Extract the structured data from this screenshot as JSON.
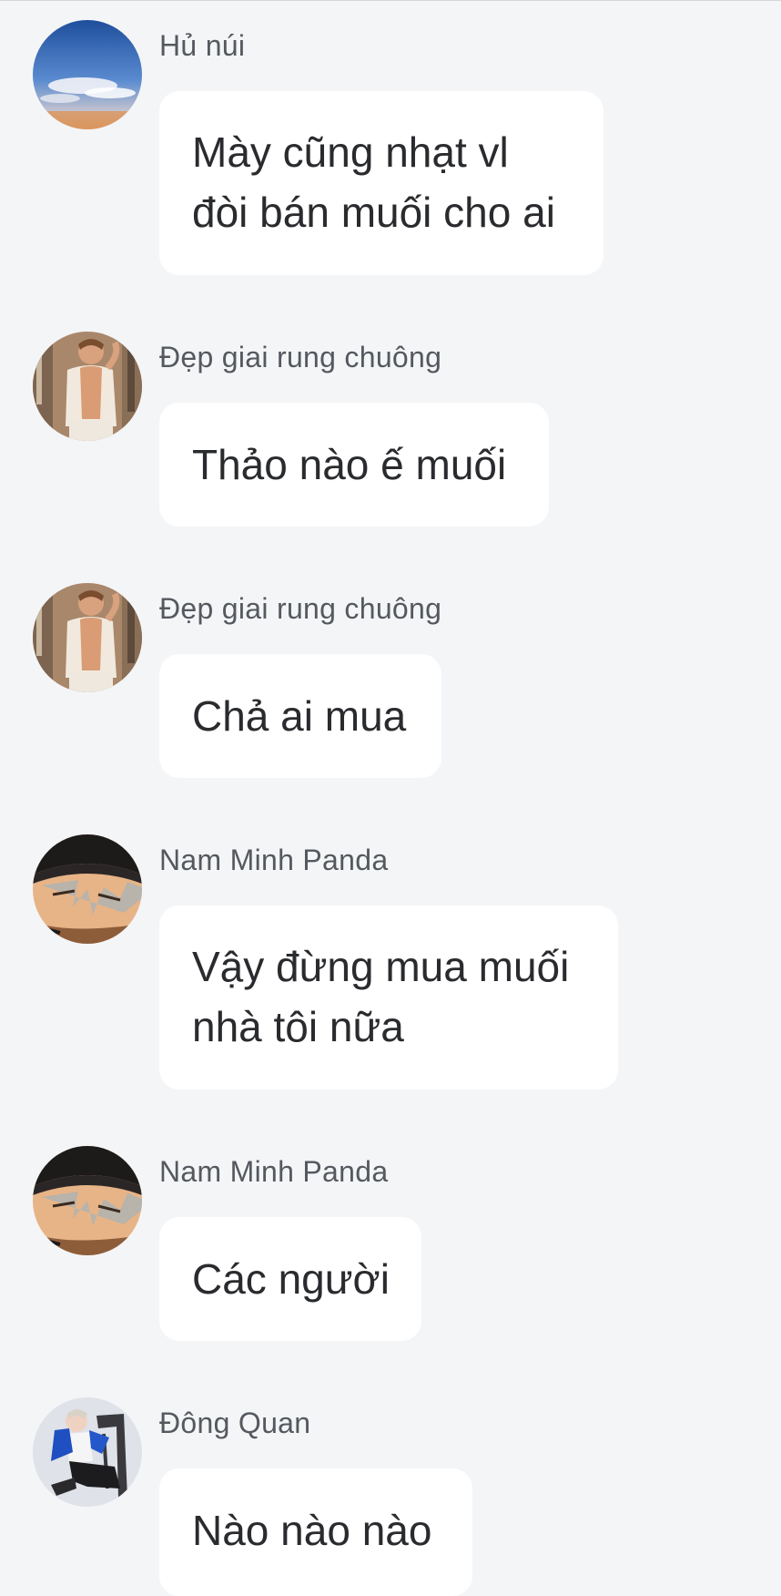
{
  "messages": [
    {
      "sender": "Hủ núi",
      "avatar_icon": "sky-clouds-avatar-icon",
      "lines": [
        "Mày cũng nhạt vl",
        "đòi bán muối cho ai"
      ]
    },
    {
      "sender": "Đẹp giai rung chuông",
      "avatar_icon": "shirtless-man-avatar-icon",
      "lines": [
        "Thảo nào ế muối"
      ]
    },
    {
      "sender": "Đẹp giai rung chuông",
      "avatar_icon": "shirtless-man-avatar-icon",
      "lines": [
        "Chả ai mua"
      ]
    },
    {
      "sender": "Nam Minh Panda",
      "avatar_icon": "anime-hat-character-avatar-icon",
      "lines": [
        "Vậy đừng mua muối",
        "nhà tôi nữa"
      ]
    },
    {
      "sender": "Nam Minh Panda",
      "avatar_icon": "anime-hat-character-avatar-icon",
      "lines": [
        "Các người"
      ]
    },
    {
      "sender": "Đông Quan",
      "avatar_icon": "person-chair-avatar-icon",
      "lines": [
        "Nào nào nào"
      ]
    }
  ],
  "colors": {
    "background": "#f4f5f7",
    "bubble": "#ffffff",
    "sender_text": "#55595f",
    "message_text": "#2a2b2e"
  }
}
